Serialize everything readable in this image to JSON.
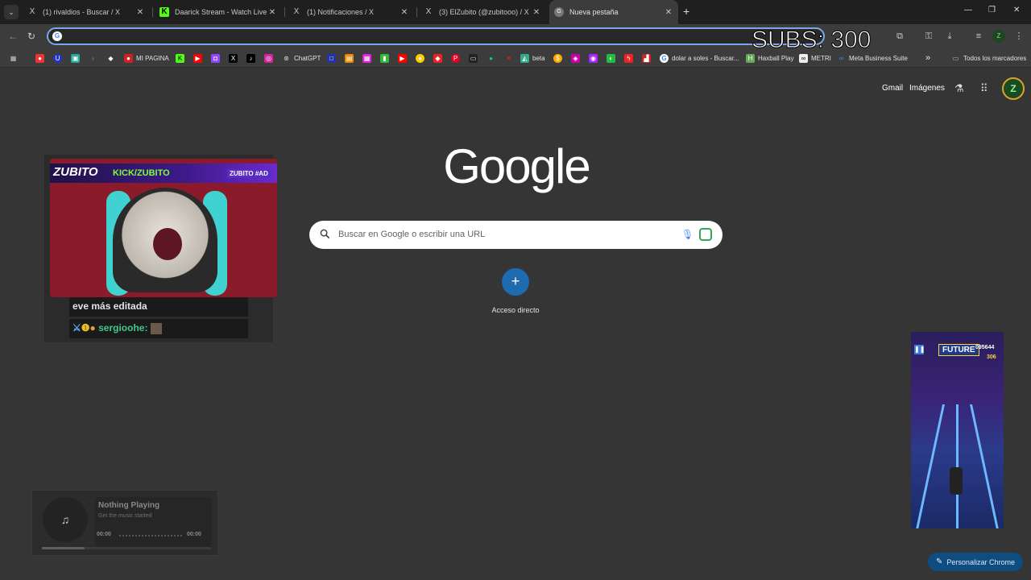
{
  "tabs": [
    {
      "title": "(1) rivaldios - Buscar / X",
      "icon": "X"
    },
    {
      "title": "Daarick Stream - Watch Live on Ki",
      "icon": "K"
    },
    {
      "title": "(1) Notificaciones / X",
      "icon": "X"
    },
    {
      "title": "(3) ElZubito (@zubitooo) / X",
      "icon": "X"
    },
    {
      "title": "Nueva pestaña",
      "icon": "G"
    }
  ],
  "new_tab_symbol": "+",
  "window_controls": {
    "minimize": "—",
    "restore": "❐",
    "close": "✕"
  },
  "overlay_subs": "SUBS: 300",
  "account_initial": "Z",
  "bookmarks": {
    "mi_pagina": "MI PAGINA",
    "chatgpt": "ChatGPT",
    "beta": "beta",
    "dolar": "dolar a soles - Buscar...",
    "haxball": "Haxball Play",
    "metri": "METRI",
    "meta": "Meta Business Suite",
    "all": "Todos los marcadores",
    "overflow": "»"
  },
  "ntp": {
    "gmail": "Gmail",
    "images": "Imágenes",
    "logo": "Google",
    "search_placeholder": "Buscar en Google o escribir una URL",
    "shortcut_symbol": "+",
    "shortcut_label": "Acceso directo",
    "customize": "Personalizar Chrome",
    "avatar": "Z"
  },
  "stream_overlay": {
    "brand": "ZUBITO",
    "kick": "KICK/ZUBITO",
    "code": "ZUBITO #AD",
    "chat": [
      {
        "text": "eve más editada"
      },
      {
        "user": "sergioohe:"
      }
    ]
  },
  "music": {
    "title": "Nothing Playing",
    "subtitle": "Get the music started",
    "time_start": "00:00",
    "time_end": "00:00",
    "progress": 0.25
  },
  "game": {
    "badge": "FUTURE",
    "score": "095644",
    "coins": "306"
  },
  "colors": {
    "page_bg": "#353535",
    "accent": "#1f6bb0",
    "omnibox_focus": "#7aa7e8",
    "chat_user": "#3fc98e"
  }
}
